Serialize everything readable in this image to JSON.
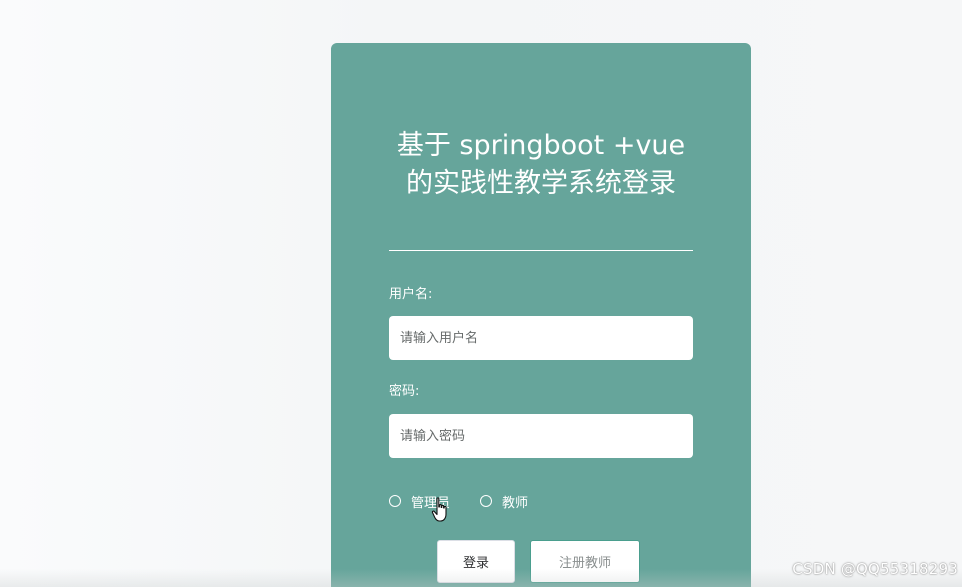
{
  "login": {
    "title_line1": "基于 springboot +vue",
    "title_line2": "的实践性教学系统登录",
    "username_label": "用户名:",
    "username_placeholder": "请输入用户名",
    "password_label": "密码:",
    "password_placeholder": "请输入密码",
    "roles": [
      {
        "label": "管理员",
        "selected": false
      },
      {
        "label": "教师",
        "selected": false
      }
    ],
    "login_button": "登录",
    "register_button": "注册教师"
  },
  "watermark": "CSDN @QQ55318293",
  "colors": {
    "card": "#66a59b",
    "register_border": "#4a9e8e"
  },
  "icons": {
    "cursor": "hand-pointer-icon"
  }
}
